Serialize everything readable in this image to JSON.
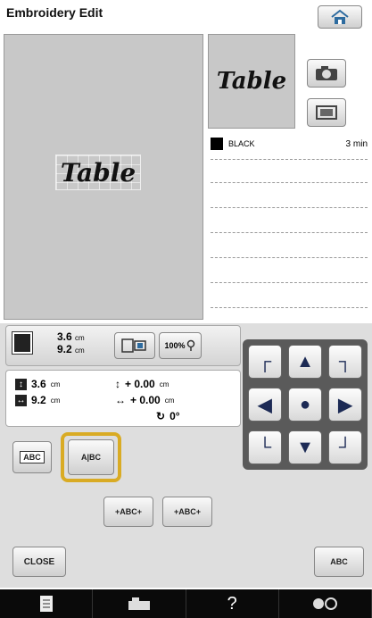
{
  "header": {
    "title": "Embroidery Edit",
    "home_icon": "home-icon"
  },
  "canvas": {
    "pattern_text": "Table",
    "background": "#c8c8c8"
  },
  "preview": {
    "pattern_text": "Table",
    "camera_icon": "camera-icon",
    "scan_icon": "scan-icon"
  },
  "threads": {
    "items": [
      {
        "color_name": "BLACK",
        "swatch": "#000000",
        "time": "3 min"
      }
    ]
  },
  "size_panel": {
    "height_value": "3.6",
    "height_unit": "cm",
    "width_value": "9.2",
    "width_unit": "cm",
    "zoom_label": "100%"
  },
  "info": {
    "height": "3.6",
    "height_unit": "cm",
    "width": "9.2",
    "width_unit": "cm",
    "offset_v": "+ 0.00",
    "offset_v_unit": "cm",
    "offset_h": "+ 0.00",
    "offset_h_unit": "cm",
    "rotation": "0°"
  },
  "buttons": {
    "array_label": "ABC",
    "spacing_label": "A|BC",
    "spacing_decrease_label": "+ABC+",
    "spacing_increase_label": "+ABC+",
    "close_label": "CLOSE",
    "text_label": "ABC"
  },
  "bottom_bar": {
    "help_label": "?"
  },
  "colors": {
    "highlight": "#d9ab24",
    "arrow": "#1c2a55"
  }
}
